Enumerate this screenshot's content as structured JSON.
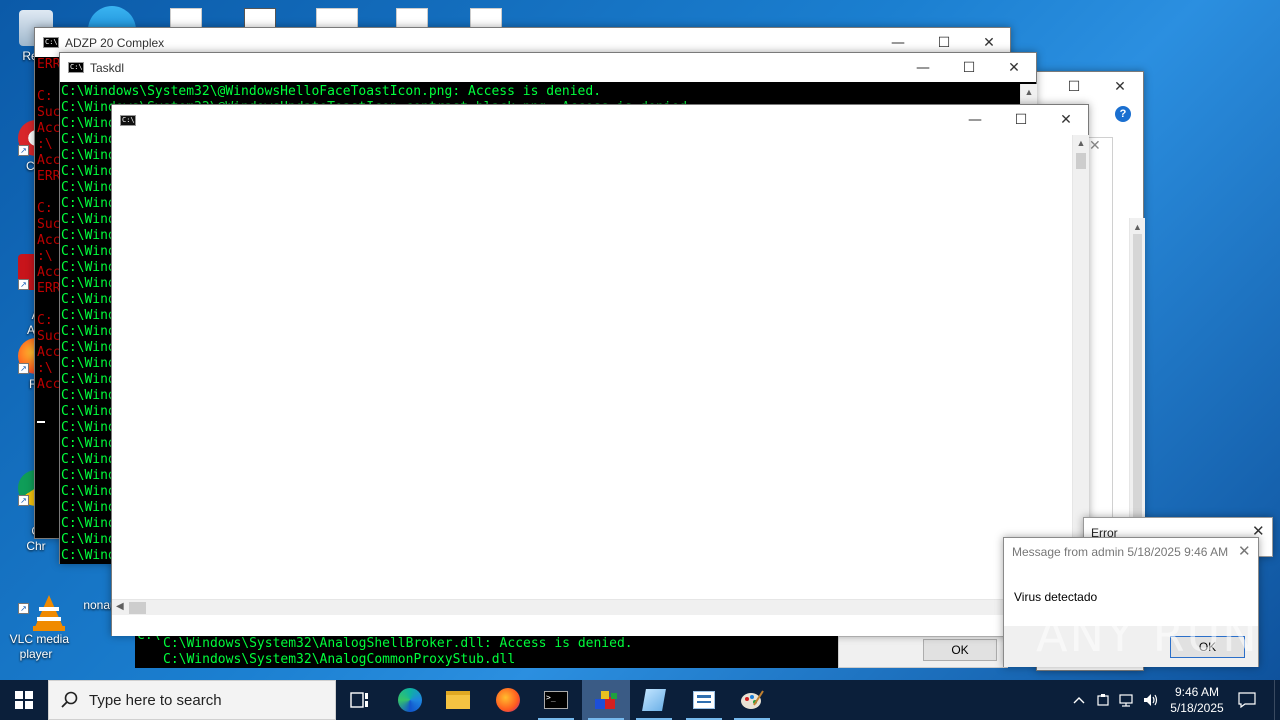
{
  "desktop": {
    "icons": [
      {
        "label": "Recy",
        "name": "recycle-bin"
      },
      {
        "label": "CCl",
        "name": "ccleaner"
      },
      {
        "label": "Ad\nAcr",
        "name": "adobe-acrobat"
      },
      {
        "label": "Fir",
        "name": "firefox"
      },
      {
        "label": "Go\nChr",
        "name": "google-chrome"
      },
      {
        "label": "VLC media\nplayer",
        "name": "vlc"
      },
      {
        "label": "nonau",
        "name": "nonau"
      }
    ]
  },
  "window_adzp": {
    "title": "ADZP 20 Complex",
    "left_lines": [
      "ERR",
      "",
      "C:",
      "Suc",
      "Acc",
      ":\\",
      "Acc",
      "ERR",
      "",
      "C:",
      "Suc",
      "Acc",
      ":\\",
      "Acc",
      "ERR",
      "",
      "C:",
      "Suc",
      "Acc",
      ":\\",
      "Acc"
    ]
  },
  "window_taskdl": {
    "title": "Taskdl",
    "lines": [
      "C:\\Windows\\System32\\@WindowsHelloFaceToastIcon.png: Access is denied.",
      "C:\\Windows\\System32\\@WindowsUpdateToastIcon.contrast-black.png: Access is denied.",
      "C:\\Wind",
      "C:\\Wind",
      "C:\\Wind",
      "C:\\Wind",
      "C:\\Wind",
      "C:\\Wind",
      "C:\\Wind",
      "C:\\Wind",
      "C:\\Wind",
      "C:\\Wind",
      "C:\\Wind",
      "C:\\Wind",
      "C:\\Wind",
      "C:\\Wind",
      "C:\\Wind",
      "C:\\Wind",
      "C:\\Wind",
      "C:\\Wind",
      "C:\\Wind",
      "C:\\Wind",
      "C:\\Wind",
      "C:\\Wind",
      "C:\\Wind",
      "C:\\Wind",
      "C:\\Wind",
      "C:\\Wind",
      "C:\\Wind",
      "C:\\Wind"
    ]
  },
  "window_bottom_console": {
    "lines": [
      "C:\\Windows\\System32\\AnalogShellBroker.dll: Access is denied.",
      "C:\\Windows\\System32\\AnalogCommonProxyStub.dll"
    ],
    "left_lines": [
      "C:\\",
      "C:\\"
    ]
  },
  "window_blank": {
    "title": ""
  },
  "error_dialog": {
    "title": "Error"
  },
  "message_dialog": {
    "title": "Message from admin 5/18/2025 9:46 AM",
    "body": "Virus detectado",
    "ok_label": "OK"
  },
  "background_dialog": {
    "ok_label": "OK"
  },
  "watermark": "ANY RUN",
  "taskbar": {
    "search_placeholder": "Type here to search",
    "time": "9:46 AM",
    "date": "5/18/2025"
  },
  "colors": {
    "console_green": "#00ff3c",
    "console_red": "#c00000",
    "taskbar_bg": "#0b1f3a",
    "accent": "#0078d7"
  }
}
